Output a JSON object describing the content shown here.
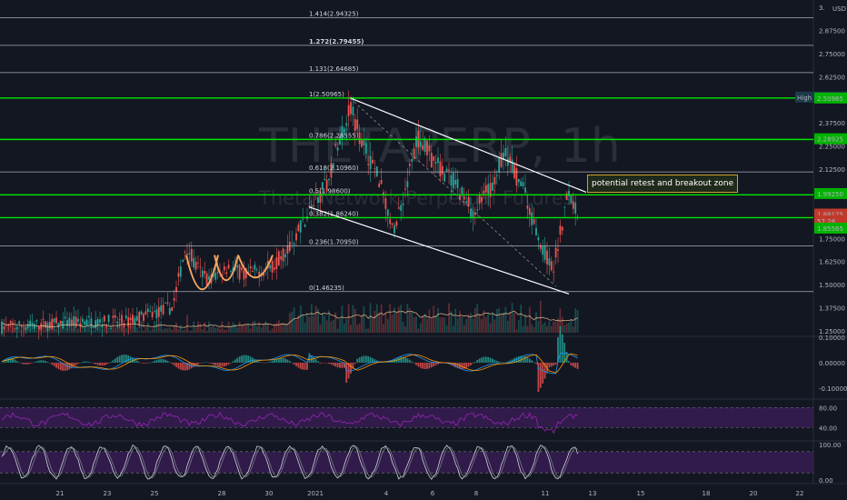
{
  "app": {
    "currency": "USD"
  },
  "watermark": {
    "symbol": "THETAPERP, 1h",
    "description": "Theta Network Perpetual Futures"
  },
  "fib_levels": [
    {
      "ratio_label": "1.414(2.94325)",
      "price": 2.94325,
      "color": "#d1d4dc",
      "bold": false
    },
    {
      "ratio_label": "1.272(2.79455)",
      "price": 2.79455,
      "color": "#d1d4dc",
      "bold": true
    },
    {
      "ratio_label": "1.131(2.64685)",
      "price": 2.64685,
      "color": "#d1d4dc",
      "bold": false
    },
    {
      "ratio_label": "1(2.50965)",
      "price": 2.50965,
      "color": "#00e600",
      "bold": false
    },
    {
      "ratio_label": "0.786(2.28555)",
      "price": 2.28555,
      "color": "#00e600",
      "bold": false
    },
    {
      "ratio_label": "0.618(2.10960)",
      "price": 2.1096,
      "color": "#d1d4dc",
      "bold": false
    },
    {
      "ratio_label": "0.5(1.98600)",
      "price": 1.986,
      "color": "#00e600",
      "bold": false
    },
    {
      "ratio_label": "0.382(1.86240)",
      "price": 1.8624,
      "color": "#00e600",
      "bold": false
    },
    {
      "ratio_label": "0.236(1.70950)",
      "price": 1.7095,
      "color": "#d1d4dc",
      "bold": false
    },
    {
      "ratio_label": "0(1.46235)",
      "price": 1.46235,
      "color": "#d1d4dc",
      "bold": false
    }
  ],
  "price_axis": {
    "ticks": [
      "3.",
      "2.87500",
      "2.75000",
      "2.62500",
      "2.50000",
      "2.37500",
      "2.25000",
      "2.12500",
      "2.00000",
      "1.87500",
      "1.75000",
      "1.62500",
      "1.50000",
      "1.37500",
      "1.25000"
    ],
    "tick_values": [
      3.0,
      2.875,
      2.75,
      2.625,
      2.5,
      2.375,
      2.25,
      2.125,
      2.0,
      1.875,
      1.75,
      1.625,
      1.5,
      1.375,
      1.25
    ],
    "range": [
      1.23,
      3.03
    ]
  },
  "price_badges": [
    {
      "label": "High",
      "value": "2.51455",
      "price": 2.51455,
      "bg": "#1e3a4a"
    },
    {
      "label": "",
      "value": "2.50965",
      "price": 2.50965,
      "bg": "#00b300"
    },
    {
      "label": "",
      "value": "2.28925",
      "price": 2.28925,
      "bg": "#00b300"
    },
    {
      "label": "",
      "value": "1.99250",
      "price": 1.9925,
      "bg": "#00b300"
    },
    {
      "label": "",
      "value": "1.88175",
      "price": 1.88175,
      "bg": "#c0392b"
    },
    {
      "label": "",
      "value": "57:28",
      "price": 1.845,
      "bg": "#c0392b"
    },
    {
      "label": "",
      "value": "1.85565",
      "price": 1.80565,
      "bg": "#00b300"
    }
  ],
  "macd_axis": {
    "ticks": [
      "0.10000",
      "0.00000",
      "-0.10000"
    ],
    "tick_values": [
      0.1,
      0.0,
      -0.1
    ],
    "range": [
      -0.14,
      0.1
    ]
  },
  "rsi_axis": {
    "ticks": [
      "80.00",
      "40.00"
    ],
    "tick_values": [
      80,
      40
    ],
    "range": [
      15,
      95
    ]
  },
  "stoch_axis": {
    "ticks": [
      "100.00",
      "0.00"
    ],
    "tick_values": [
      100,
      0
    ],
    "range": [
      -8,
      108
    ]
  },
  "time_axis": {
    "labels": [
      "21",
      "23",
      "25",
      "28",
      "30",
      "2021",
      "4",
      "6",
      "8",
      "11",
      "13",
      "15",
      "18",
      "20",
      "22"
    ]
  },
  "annotation": {
    "text": "potential retest and breakout zone"
  },
  "colors": {
    "bull": "#26a69a",
    "bear": "#ef5350",
    "fib_green": "#00e600",
    "channel": "#ffffff",
    "rsi": "#8e24aa",
    "rsi_fill": "#4a1f6e",
    "macd": "#2196f3",
    "signal": "#ff9800",
    "volume_ma": "#ffcc99",
    "pattern": "#f4a460"
  }
}
